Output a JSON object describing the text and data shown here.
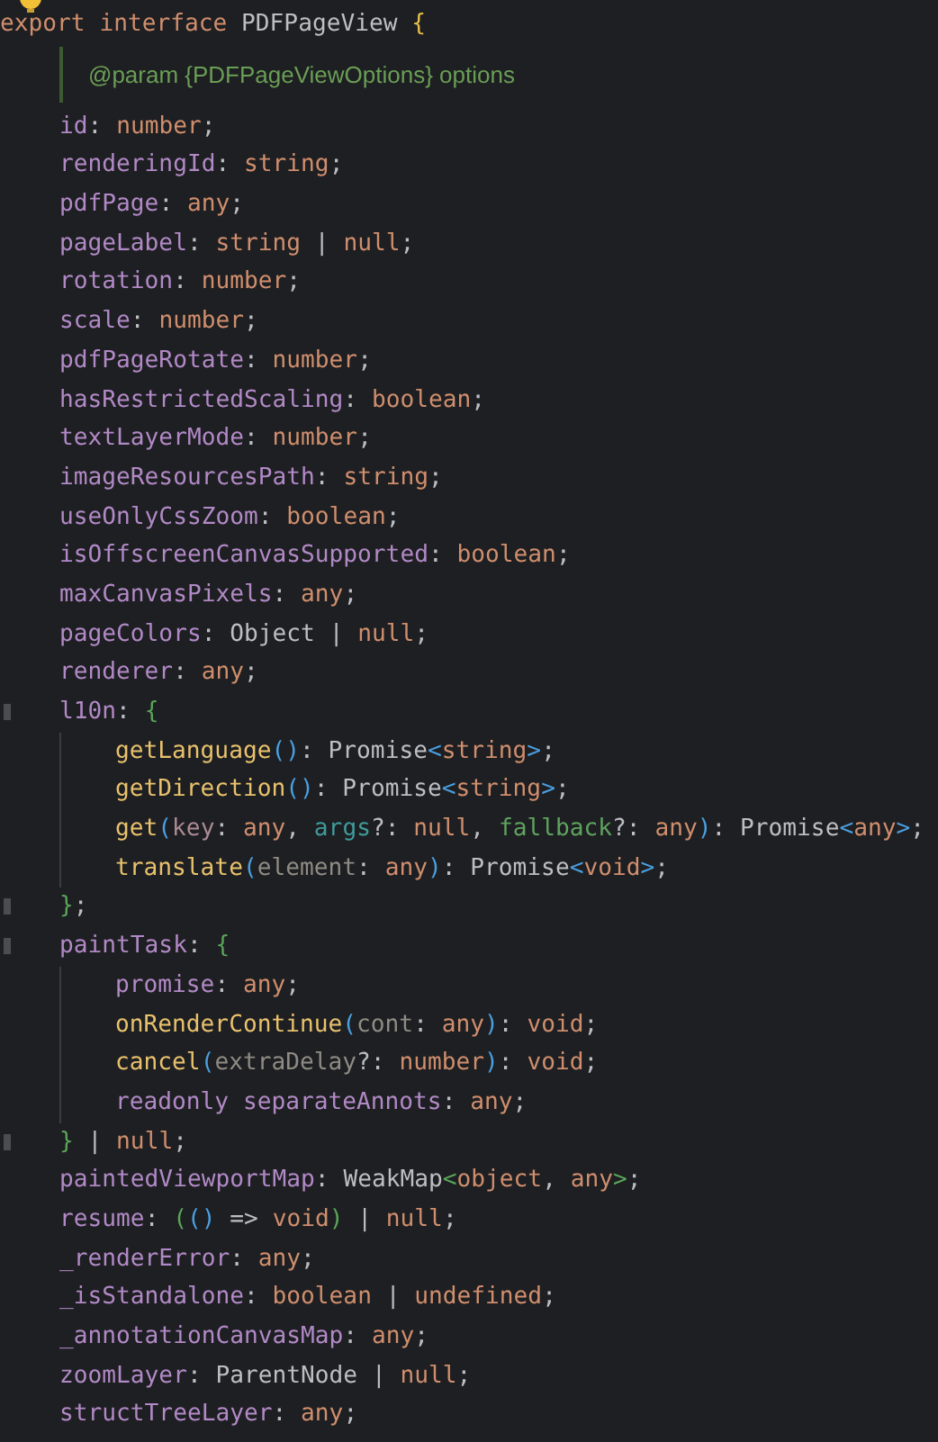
{
  "editor": {
    "lines": [
      {
        "tokens": [
          {
            "kind": "kw",
            "t": "export "
          },
          {
            "kind": "kw",
            "t": "interface "
          },
          {
            "kind": "name",
            "t": "PDFPageView "
          },
          {
            "kind": "gold",
            "t": "{"
          }
        ],
        "children": [
          {
            "kind": "doc",
            "text": "@param {PDFPageViewOptions} options"
          },
          {
            "tokens": [
              {
                "kind": "prop",
                "t": "id"
              },
              {
                "kind": "punct",
                "t": ": "
              },
              {
                "kind": "type",
                "t": "number"
              },
              {
                "kind": "punct",
                "t": ";"
              }
            ]
          },
          {
            "tokens": [
              {
                "kind": "prop",
                "t": "renderingId"
              },
              {
                "kind": "punct",
                "t": ": "
              },
              {
                "kind": "type",
                "t": "string"
              },
              {
                "kind": "punct",
                "t": ";"
              }
            ]
          },
          {
            "tokens": [
              {
                "kind": "prop",
                "t": "pdfPage"
              },
              {
                "kind": "punct",
                "t": ": "
              },
              {
                "kind": "type",
                "t": "any"
              },
              {
                "kind": "punct",
                "t": ";"
              }
            ]
          },
          {
            "tokens": [
              {
                "kind": "prop",
                "t": "pageLabel"
              },
              {
                "kind": "punct",
                "t": ": "
              },
              {
                "kind": "type",
                "t": "string"
              },
              {
                "kind": "punct",
                "t": " | "
              },
              {
                "kind": "type",
                "t": "null"
              },
              {
                "kind": "punct",
                "t": ";"
              }
            ]
          },
          {
            "tokens": [
              {
                "kind": "prop",
                "t": "rotation"
              },
              {
                "kind": "punct",
                "t": ": "
              },
              {
                "kind": "type",
                "t": "number"
              },
              {
                "kind": "punct",
                "t": ";"
              }
            ]
          },
          {
            "tokens": [
              {
                "kind": "prop",
                "t": "scale"
              },
              {
                "kind": "punct",
                "t": ": "
              },
              {
                "kind": "type",
                "t": "number"
              },
              {
                "kind": "punct",
                "t": ";"
              }
            ]
          },
          {
            "tokens": [
              {
                "kind": "prop",
                "t": "pdfPageRotate"
              },
              {
                "kind": "punct",
                "t": ": "
              },
              {
                "kind": "type",
                "t": "number"
              },
              {
                "kind": "punct",
                "t": ";"
              }
            ]
          },
          {
            "tokens": [
              {
                "kind": "prop",
                "t": "hasRestrictedScaling"
              },
              {
                "kind": "punct",
                "t": ": "
              },
              {
                "kind": "type",
                "t": "boolean"
              },
              {
                "kind": "punct",
                "t": ";"
              }
            ]
          },
          {
            "tokens": [
              {
                "kind": "prop",
                "t": "textLayerMode"
              },
              {
                "kind": "punct",
                "t": ": "
              },
              {
                "kind": "type",
                "t": "number"
              },
              {
                "kind": "punct",
                "t": ";"
              }
            ]
          },
          {
            "tokens": [
              {
                "kind": "prop",
                "t": "imageResourcesPath"
              },
              {
                "kind": "punct",
                "t": ": "
              },
              {
                "kind": "type",
                "t": "string"
              },
              {
                "kind": "punct",
                "t": ";"
              }
            ]
          },
          {
            "tokens": [
              {
                "kind": "prop",
                "t": "useOnlyCssZoom"
              },
              {
                "kind": "punct",
                "t": ": "
              },
              {
                "kind": "type",
                "t": "boolean"
              },
              {
                "kind": "punct",
                "t": ";"
              }
            ]
          },
          {
            "tokens": [
              {
                "kind": "prop",
                "t": "isOffscreenCanvasSupported"
              },
              {
                "kind": "punct",
                "t": ": "
              },
              {
                "kind": "type",
                "t": "boolean"
              },
              {
                "kind": "punct",
                "t": ";"
              }
            ]
          },
          {
            "tokens": [
              {
                "kind": "prop",
                "t": "maxCanvasPixels"
              },
              {
                "kind": "punct",
                "t": ": "
              },
              {
                "kind": "type",
                "t": "any"
              },
              {
                "kind": "punct",
                "t": ";"
              }
            ]
          },
          {
            "tokens": [
              {
                "kind": "prop",
                "t": "pageColors"
              },
              {
                "kind": "punct",
                "t": ": "
              },
              {
                "kind": "name",
                "t": "Object"
              },
              {
                "kind": "punct",
                "t": " | "
              },
              {
                "kind": "type",
                "t": "null"
              },
              {
                "kind": "punct",
                "t": ";"
              }
            ]
          },
          {
            "tokens": [
              {
                "kind": "prop",
                "t": "renderer"
              },
              {
                "kind": "punct",
                "t": ": "
              },
              {
                "kind": "type",
                "t": "any"
              },
              {
                "kind": "punct",
                "t": ";"
              }
            ]
          },
          {
            "tokens": [
              {
                "kind": "prop",
                "t": "l10n"
              },
              {
                "kind": "punct",
                "t": ": "
              },
              {
                "kind": "green",
                "t": "{"
              }
            ],
            "children": [
              {
                "tokens": [
                  {
                    "kind": "method",
                    "t": "getLanguage"
                  },
                  {
                    "kind": "blue",
                    "t": "()"
                  },
                  {
                    "kind": "punct",
                    "t": ": "
                  },
                  {
                    "kind": "name",
                    "t": "Promise"
                  },
                  {
                    "kind": "blue",
                    "t": "<"
                  },
                  {
                    "kind": "type",
                    "t": "string"
                  },
                  {
                    "kind": "blue",
                    "t": ">"
                  },
                  {
                    "kind": "punct",
                    "t": ";"
                  }
                ]
              },
              {
                "tokens": [
                  {
                    "kind": "method",
                    "t": "getDirection"
                  },
                  {
                    "kind": "blue",
                    "t": "()"
                  },
                  {
                    "kind": "punct",
                    "t": ": "
                  },
                  {
                    "kind": "name",
                    "t": "Promise"
                  },
                  {
                    "kind": "blue",
                    "t": "<"
                  },
                  {
                    "kind": "type",
                    "t": "string"
                  },
                  {
                    "kind": "blue",
                    "t": ">"
                  },
                  {
                    "kind": "punct",
                    "t": ";"
                  }
                ]
              },
              {
                "tokens": [
                  {
                    "kind": "method",
                    "t": "get"
                  },
                  {
                    "kind": "blue",
                    "t": "("
                  },
                  {
                    "kind": "p1",
                    "t": "key"
                  },
                  {
                    "kind": "punct",
                    "t": ": "
                  },
                  {
                    "kind": "type",
                    "t": "any"
                  },
                  {
                    "kind": "punct",
                    "t": ", "
                  },
                  {
                    "kind": "p2",
                    "t": "args"
                  },
                  {
                    "kind": "punct",
                    "t": "?: "
                  },
                  {
                    "kind": "type",
                    "t": "null"
                  },
                  {
                    "kind": "punct",
                    "t": ", "
                  },
                  {
                    "kind": "p3",
                    "t": "fallback"
                  },
                  {
                    "kind": "punct",
                    "t": "?: "
                  },
                  {
                    "kind": "type",
                    "t": "any"
                  },
                  {
                    "kind": "blue",
                    "t": ")"
                  },
                  {
                    "kind": "punct",
                    "t": ": "
                  },
                  {
                    "kind": "name",
                    "t": "Promise"
                  },
                  {
                    "kind": "blue",
                    "t": "<"
                  },
                  {
                    "kind": "type",
                    "t": "any"
                  },
                  {
                    "kind": "blue",
                    "t": ">"
                  },
                  {
                    "kind": "punct",
                    "t": ";"
                  }
                ]
              },
              {
                "tokens": [
                  {
                    "kind": "method",
                    "t": "translate"
                  },
                  {
                    "kind": "blue",
                    "t": "("
                  },
                  {
                    "kind": "p4",
                    "t": "element"
                  },
                  {
                    "kind": "punct",
                    "t": ": "
                  },
                  {
                    "kind": "type",
                    "t": "any"
                  },
                  {
                    "kind": "blue",
                    "t": ")"
                  },
                  {
                    "kind": "punct",
                    "t": ": "
                  },
                  {
                    "kind": "name",
                    "t": "Promise"
                  },
                  {
                    "kind": "blue",
                    "t": "<"
                  },
                  {
                    "kind": "type",
                    "t": "void"
                  },
                  {
                    "kind": "blue",
                    "t": ">"
                  },
                  {
                    "kind": "punct",
                    "t": ";"
                  }
                ]
              }
            ],
            "close": [
              {
                "kind": "green",
                "t": "}"
              },
              {
                "kind": "punct",
                "t": ";"
              }
            ]
          },
          {
            "tokens": [
              {
                "kind": "prop",
                "t": "paintTask"
              },
              {
                "kind": "punct",
                "t": ": "
              },
              {
                "kind": "green",
                "t": "{"
              }
            ],
            "children": [
              {
                "tokens": [
                  {
                    "kind": "prop",
                    "t": "promise"
                  },
                  {
                    "kind": "punct",
                    "t": ": "
                  },
                  {
                    "kind": "type",
                    "t": "any"
                  },
                  {
                    "kind": "punct",
                    "t": ";"
                  }
                ]
              },
              {
                "tokens": [
                  {
                    "kind": "method",
                    "t": "onRenderContinue"
                  },
                  {
                    "kind": "blue",
                    "t": "("
                  },
                  {
                    "kind": "p4",
                    "t": "cont"
                  },
                  {
                    "kind": "punct",
                    "t": ": "
                  },
                  {
                    "kind": "type",
                    "t": "any"
                  },
                  {
                    "kind": "blue",
                    "t": ")"
                  },
                  {
                    "kind": "punct",
                    "t": ": "
                  },
                  {
                    "kind": "type",
                    "t": "void"
                  },
                  {
                    "kind": "punct",
                    "t": ";"
                  }
                ]
              },
              {
                "tokens": [
                  {
                    "kind": "method",
                    "t": "cancel"
                  },
                  {
                    "kind": "blue",
                    "t": "("
                  },
                  {
                    "kind": "p4",
                    "t": "extraDelay"
                  },
                  {
                    "kind": "punct",
                    "t": "?: "
                  },
                  {
                    "kind": "type",
                    "t": "number"
                  },
                  {
                    "kind": "blue",
                    "t": ")"
                  },
                  {
                    "kind": "punct",
                    "t": ": "
                  },
                  {
                    "kind": "type",
                    "t": "void"
                  },
                  {
                    "kind": "punct",
                    "t": ";"
                  }
                ]
              },
              {
                "tokens": [
                  {
                    "kind": "prop",
                    "t": "readonly separateAnnots"
                  },
                  {
                    "kind": "punct",
                    "t": ": "
                  },
                  {
                    "kind": "type",
                    "t": "any"
                  },
                  {
                    "kind": "punct",
                    "t": ";"
                  }
                ]
              }
            ],
            "close": [
              {
                "kind": "green",
                "t": "}"
              },
              {
                "kind": "punct",
                "t": " | "
              },
              {
                "kind": "type",
                "t": "null"
              },
              {
                "kind": "punct",
                "t": ";"
              }
            ]
          },
          {
            "tokens": [
              {
                "kind": "prop",
                "t": "paintedViewportMap"
              },
              {
                "kind": "punct",
                "t": ": "
              },
              {
                "kind": "name",
                "t": "WeakMap"
              },
              {
                "kind": "green",
                "t": "<"
              },
              {
                "kind": "type",
                "t": "object"
              },
              {
                "kind": "punct",
                "t": ", "
              },
              {
                "kind": "type",
                "t": "any"
              },
              {
                "kind": "green",
                "t": ">"
              },
              {
                "kind": "punct",
                "t": ";"
              }
            ]
          },
          {
            "tokens": [
              {
                "kind": "prop",
                "t": "resume"
              },
              {
                "kind": "punct",
                "t": ": "
              },
              {
                "kind": "green",
                "t": "("
              },
              {
                "kind": "blue",
                "t": "()"
              },
              {
                "kind": "punct",
                "t": " => "
              },
              {
                "kind": "type",
                "t": "void"
              },
              {
                "kind": "green",
                "t": ")"
              },
              {
                "kind": "punct",
                "t": " | "
              },
              {
                "kind": "type",
                "t": "null"
              },
              {
                "kind": "punct",
                "t": ";"
              }
            ]
          },
          {
            "tokens": [
              {
                "kind": "prop",
                "t": "_renderError"
              },
              {
                "kind": "punct",
                "t": ": "
              },
              {
                "kind": "type",
                "t": "any"
              },
              {
                "kind": "punct",
                "t": ";"
              }
            ]
          },
          {
            "tokens": [
              {
                "kind": "prop",
                "t": "_isStandalone"
              },
              {
                "kind": "punct",
                "t": ": "
              },
              {
                "kind": "type",
                "t": "boolean"
              },
              {
                "kind": "punct",
                "t": " | "
              },
              {
                "kind": "type",
                "t": "undefined"
              },
              {
                "kind": "punct",
                "t": ";"
              }
            ]
          },
          {
            "tokens": [
              {
                "kind": "prop",
                "t": "_annotationCanvasMap"
              },
              {
                "kind": "punct",
                "t": ": "
              },
              {
                "kind": "type",
                "t": "any"
              },
              {
                "kind": "punct",
                "t": ";"
              }
            ]
          },
          {
            "tokens": [
              {
                "kind": "prop",
                "t": "zoomLayer"
              },
              {
                "kind": "punct",
                "t": ": "
              },
              {
                "kind": "name",
                "t": "ParentNode"
              },
              {
                "kind": "punct",
                "t": " | "
              },
              {
                "kind": "type",
                "t": "null"
              },
              {
                "kind": "punct",
                "t": ";"
              }
            ]
          },
          {
            "tokens": [
              {
                "kind": "prop",
                "t": "structTreeLayer"
              },
              {
                "kind": "punct",
                "t": ": "
              },
              {
                "kind": "type",
                "t": "any"
              },
              {
                "kind": "punct",
                "t": ";"
              }
            ]
          }
        ]
      }
    ]
  }
}
